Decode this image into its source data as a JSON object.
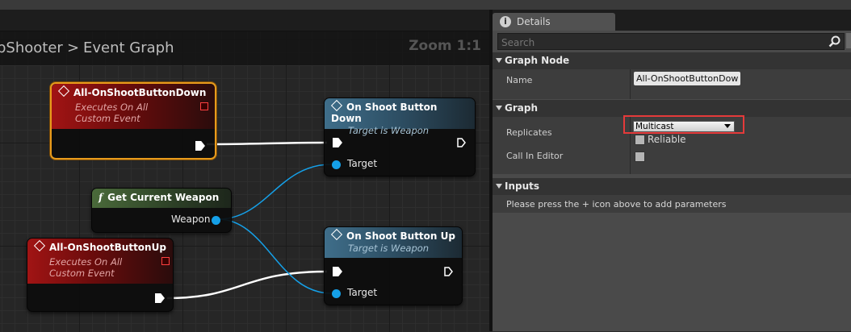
{
  "graph": {
    "breadcrumb_parent": "pShooter",
    "breadcrumb_sep": ">",
    "breadcrumb_current": "Event Graph",
    "zoom": "Zoom 1:1",
    "nodes": {
      "event_down": {
        "title": "All-OnShootButtonDown",
        "subtitle1": "Executes On All",
        "subtitle2": "Custom Event"
      },
      "event_up": {
        "title": "All-OnShootButtonUp",
        "subtitle1": "Executes On All",
        "subtitle2": "Custom Event"
      },
      "call_down": {
        "title": "On Shoot Button Down",
        "subtitle": "Target is Weapon",
        "pin_target": "Target"
      },
      "call_up": {
        "title": "On Shoot Button Up",
        "subtitle": "Target is Weapon",
        "pin_target": "Target"
      },
      "get_weapon": {
        "title": "Get Current Weapon",
        "icon": "f",
        "pin_out": "Weapon"
      }
    },
    "colors": {
      "exec": "#ffffff",
      "object_pin": "#15a0e8",
      "selected": "#e89b1c"
    }
  },
  "details": {
    "tab_title": "Details",
    "search_placeholder": "Search",
    "sections": {
      "graph_node": "Graph Node",
      "graph": "Graph",
      "inputs": "Inputs"
    },
    "name_label": "Name",
    "name_value": "All-OnShootButtonDow",
    "replicates_label": "Replicates",
    "replicates_value": "Multicast",
    "reliable_label": "Reliable",
    "call_in_editor_label": "Call In Editor",
    "inputs_hint": "Please press the + icon above to add parameters",
    "highlight_color": "#e53a3a"
  }
}
